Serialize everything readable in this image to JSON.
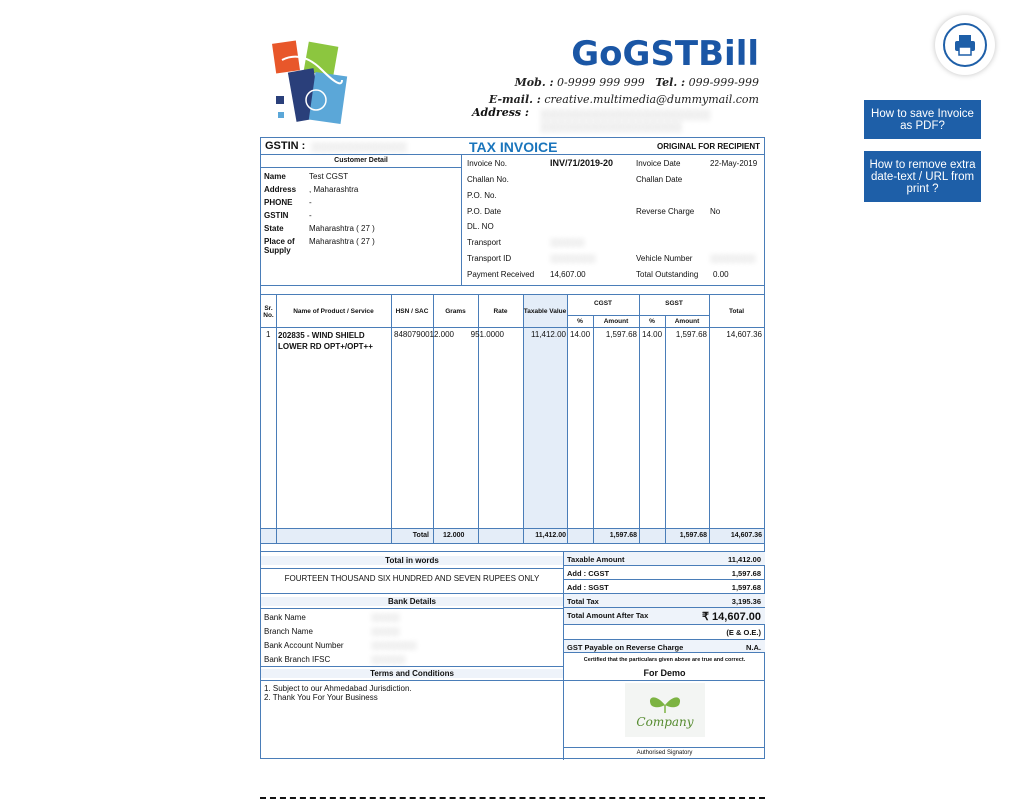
{
  "brand": "GoGSTBill",
  "contact": {
    "mob_label": "Mob. :",
    "mob": "0-9999 999 999",
    "tel_label": "Tel. :",
    "tel": "099-999-999",
    "email_label": "E-mail. :",
    "email": "creative.multimedia@dummymail.com",
    "address_label": "Address :"
  },
  "header": {
    "gstin_label": "GSTIN :",
    "title": "TAX INVOICE",
    "copy": "ORIGINAL FOR RECIPIENT"
  },
  "customer": {
    "heading": "Customer Detail",
    "rows": [
      {
        "k": "Name",
        "v": "Test CGST"
      },
      {
        "k": "Address",
        "v": ", Maharashtra"
      },
      {
        "k": "PHONE",
        "v": "-"
      },
      {
        "k": "GSTIN",
        "v": "-"
      },
      {
        "k": "State",
        "v": "Maharashtra ( 27 )"
      },
      {
        "k": "Place of Supply",
        "v": "Maharashtra ( 27 )"
      }
    ]
  },
  "meta": {
    "invoice_no_label": "Invoice No.",
    "invoice_no": "INV/71/2019-20",
    "invoice_date_label": "Invoice Date",
    "invoice_date": "22-May-2019",
    "challan_no_label": "Challan No.",
    "challan_date_label": "Challan Date",
    "po_no_label": "P.O. No.",
    "po_date_label": "P.O. Date",
    "reverse_label": "Reverse Charge",
    "reverse": "No",
    "dl_label": "DL. NO",
    "transport_label": "Transport",
    "transport_id_label": "Transport ID",
    "vehicle_label": "Vehicle Number",
    "payment_label": "Payment Received",
    "payment": "14,607.00",
    "outstanding_label": "Total Outstanding",
    "outstanding": "0.00"
  },
  "table": {
    "headers": {
      "sr": "Sr. No.",
      "name": "Name of Product / Service",
      "hsn": "HSN / SAC",
      "grams": "Grams",
      "rate": "Rate",
      "taxable": "Taxable Value",
      "cgst": "CGST",
      "sgst": "SGST",
      "pct": "%",
      "amount": "Amount",
      "total": "Total"
    },
    "row": {
      "sr": "1",
      "name": "202835 - WIND SHIELD LOWER RD OPT+/OPT++",
      "hsn": "84807900",
      "grams": "12.000",
      "rate": "951.0000",
      "taxable": "11,412.00",
      "cgst_pct": "14.00",
      "cgst_amt": "1,597.68",
      "sgst_pct": "14.00",
      "sgst_amt": "1,597.68",
      "total": "14,607.36"
    },
    "totals": {
      "label": "Total",
      "grams": "12.000",
      "taxable": "11,412.00",
      "cgst": "1,597.68",
      "sgst": "1,597.68",
      "total": "14,607.36"
    }
  },
  "words": {
    "heading": "Total in words",
    "text": "FOURTEEN THOUSAND SIX HUNDRED AND SEVEN RUPEES ONLY"
  },
  "bank": {
    "heading": "Bank Details",
    "rows": [
      "Bank Name",
      "Branch Name",
      "Bank Account Number",
      "Bank Branch IFSC"
    ]
  },
  "terms": {
    "heading": "Terms and Conditions",
    "line1": "1. Subject to our Ahmedabad Jurisdiction.",
    "line2": "2. Thank You For Your Business"
  },
  "summary": {
    "taxable_label": "Taxable Amount",
    "taxable": "11,412.00",
    "cgst_label": "Add : CGST",
    "cgst": "1,597.68",
    "sgst_label": "Add : SGST",
    "sgst": "1,597.68",
    "total_tax_label": "Total Tax",
    "total_tax": "3,195.36",
    "after_tax_label": "Total Amount After Tax",
    "after_tax": "₹ 14,607.00",
    "eoe": "(E & O.E.)",
    "reverse_label": "GST Payable on Reverse Charge",
    "reverse": "N.A.",
    "certified": "Certified that the particulars given above are true and correct.",
    "for": "For Demo",
    "company_logo_text": "Company",
    "signatory": "Authorised Signatory"
  },
  "side": {
    "btn1": "How to save Invoice as PDF?",
    "btn2": "How to remove extra date-text / URL from print ?"
  },
  "colors": {
    "brand": "#1a56a5",
    "accent": "#1a75bc",
    "button": "#1e5fa8",
    "border": "#4a7db8"
  }
}
